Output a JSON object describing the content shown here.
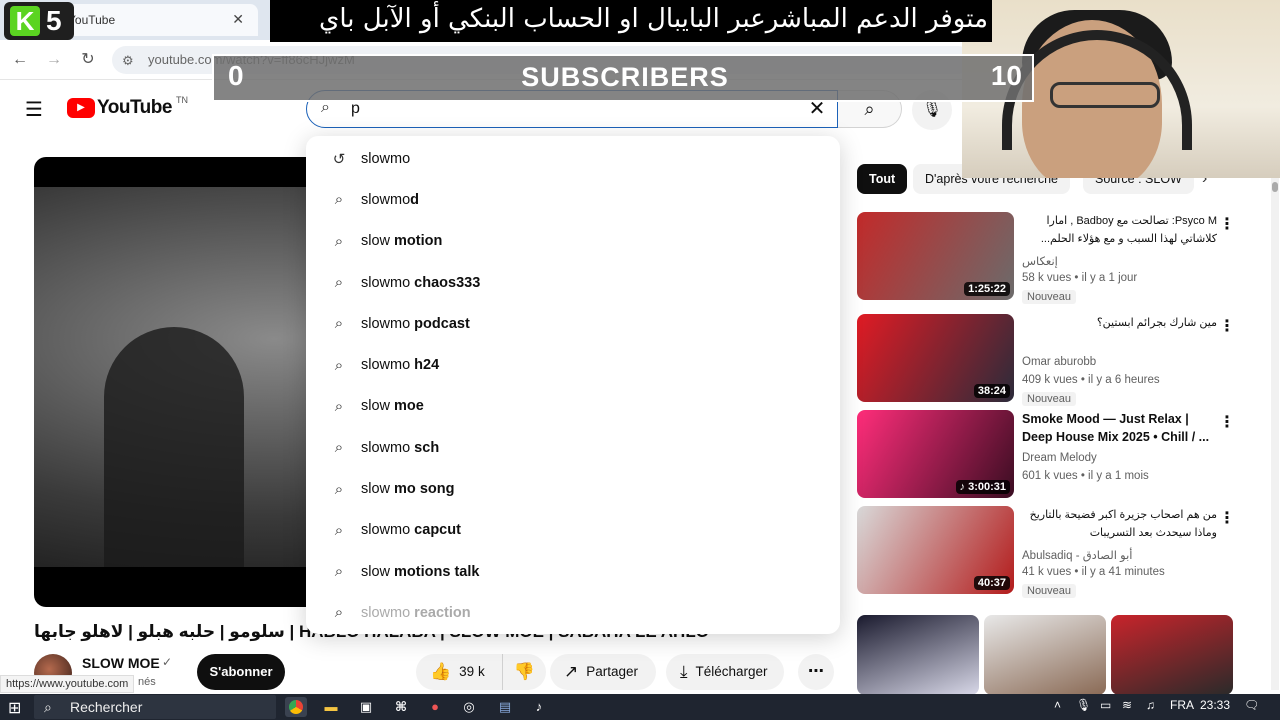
{
  "browser": {
    "tab_title": "YouTube",
    "tab_close": "✕",
    "tab_badge_letter": "K",
    "tab_badge_number": "5",
    "url": "youtube.com/watch?v=ff86cHJjwzM",
    "nav_back": "←",
    "nav_forward": "→",
    "nav_reload": "↻",
    "site_info_icon": "⚙"
  },
  "overlay": {
    "arabic_banner": "متوفر الدعم المباشرعبر البايبال او الحساب البنكي أو الآبل باي",
    "subscriber_goal": {
      "current": "0",
      "label": "SUBSCRIBERS",
      "goal": "10"
    }
  },
  "header": {
    "menu_icon": "☰",
    "logo_text": "YouTube",
    "logo_region": "TN",
    "search_value": "p",
    "search_icon": "⌕",
    "clear_icon": "✕",
    "mic_icon": "🎙"
  },
  "suggestions": [
    {
      "icon": "history-icon",
      "glyph": "↺",
      "prefix": "slowmo",
      "bold": "",
      "faded": false
    },
    {
      "icon": "search-icon",
      "glyph": "⌕",
      "prefix": "slowmo",
      "bold": "d",
      "faded": false
    },
    {
      "icon": "search-icon",
      "glyph": "⌕",
      "prefix": "slow",
      "bold": " motion",
      "faded": false
    },
    {
      "icon": "search-icon",
      "glyph": "⌕",
      "prefix": "slowmo",
      "bold": " chaos333",
      "faded": false
    },
    {
      "icon": "search-icon",
      "glyph": "⌕",
      "prefix": "slowmo",
      "bold": " podcast",
      "faded": false
    },
    {
      "icon": "search-icon",
      "glyph": "⌕",
      "prefix": "slowmo",
      "bold": " h24",
      "faded": false
    },
    {
      "icon": "search-icon",
      "glyph": "⌕",
      "prefix": "slow",
      "bold": " moe",
      "faded": false
    },
    {
      "icon": "search-icon",
      "glyph": "⌕",
      "prefix": "slowmo",
      "bold": " sch",
      "faded": false
    },
    {
      "icon": "search-icon",
      "glyph": "⌕",
      "prefix": "slow",
      "bold": " mo song",
      "faded": false
    },
    {
      "icon": "search-icon",
      "glyph": "⌕",
      "prefix": "slowmo",
      "bold": " capcut",
      "faded": false
    },
    {
      "icon": "search-icon",
      "glyph": "⌕",
      "prefix": "slow",
      "bold": " motions talk",
      "faded": false
    },
    {
      "icon": "search-icon",
      "glyph": "⌕",
      "prefix": "slowmo",
      "bold": " reaction",
      "faded": true
    }
  ],
  "video": {
    "title": "سلومو | حلبه هبلو | لاهلو جابها | HABLO HALABA | SLOW MOE | SABAHA LE AHLO",
    "channel": "SLOW MOE",
    "verified_icon": "✓",
    "subs_fragment": "nés",
    "subscribe_label": "S'abonner",
    "likes": "39 k",
    "like_icon": "👍",
    "dislike_icon": "👎",
    "share_label": "Partager",
    "share_icon": "↗",
    "download_label": "Télécharger",
    "download_icon": "⤓",
    "more_icon": "⋯"
  },
  "status_url": "https://www.youtube.com",
  "chips": {
    "items": [
      "Tout",
      "D'après votre recherche",
      "Source : SLOW"
    ],
    "active_index": 0,
    "next_icon": "›"
  },
  "recommendations": [
    {
      "title": "Psyco M: تصالحت مع Badboy , امارا كلاشاتي لهذا السبب و مع هؤلاء الحلم...",
      "channel": "إنعكاس",
      "meta": "58 k vues • il y a 1 jour",
      "badge": "Nouveau",
      "duration": "1:25:22",
      "thumb_colors": [
        "#c22a2a",
        "#6b6b6b"
      ],
      "rtl": true
    },
    {
      "title": "مين شارك بجرائم ابستين؟",
      "channel": "Omar aburobb",
      "meta": "409 k vues • il y a 6 heures",
      "badge": "Nouveau",
      "duration": "38:24",
      "thumb_colors": [
        "#e01b24",
        "#2b2b3a"
      ],
      "rtl": true
    },
    {
      "title": "Smoke Mood — Just Relax | Deep House Mix 2025 • Chill / ...",
      "channel": "Dream Melody",
      "meta": "601 k vues • il y a 1 mois",
      "badge": "",
      "duration": "♪ 3:00:31",
      "thumb_colors": [
        "#ff2d7a",
        "#3a0d22"
      ],
      "rtl": false
    },
    {
      "title": "من هم اصحاب جزيرة اكبر فضيحة بالتاريخ وماذا سيحدث بعد التسريبات",
      "channel": "Abulsadiq - أبو الصادق",
      "meta": "41 k vues • il y a 41 minutes",
      "badge": "Nouveau",
      "duration": "40:37",
      "thumb_colors": [
        "#d9d9d9",
        "#b31b1b"
      ],
      "rtl": true
    }
  ],
  "shorts": [
    {
      "colors": [
        "#1a1a2e",
        "#d8d8e8"
      ]
    },
    {
      "colors": [
        "#e8e8e8",
        "#8a6a55"
      ]
    },
    {
      "colors": [
        "#c8242b",
        "#2a2a2a"
      ]
    }
  ],
  "taskbar": {
    "start_icon": "⊞",
    "search_label": "Rechercher",
    "search_icon": "⌕",
    "language": "FRA",
    "time": "23:33",
    "notification_icon": "🗨"
  },
  "accent_colors": {
    "youtube_red": "#ff0000",
    "search_focus": "#1c62b9",
    "subscribe_bg": "#0f0f0f"
  }
}
